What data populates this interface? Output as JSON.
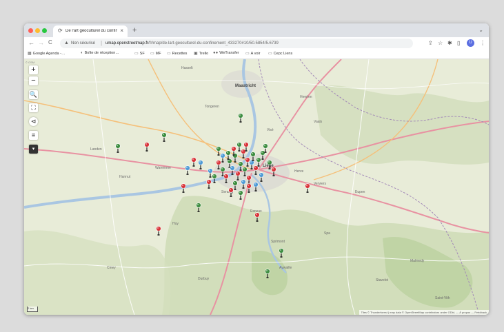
{
  "browser": {
    "tab_title": "De l'art géoculturel du confin…",
    "tab_close": "×",
    "newtab": "+",
    "tabmenu": "⌄",
    "tab_favicon": "refresh-icon",
    "back": "←",
    "forward": "→",
    "reload": "C",
    "security_label": "Non sécurisé",
    "url_host": "umap.openstreetmap.fr",
    "url_path": "/fr/map/de-lart-geoculturel-du-confinement_433270#10/50.5854/5.6739",
    "avatar_initial": "U"
  },
  "bookmarks": [
    {
      "icon": "▦",
      "label": "Google Agenda -…"
    },
    {
      "icon": "◐",
      "label": "Boîte de réception…"
    },
    {
      "icon": "▭",
      "label": "SF"
    },
    {
      "icon": "▭",
      "label": "MF"
    },
    {
      "icon": "▭",
      "label": "Recettes"
    },
    {
      "icon": "▣",
      "label": "Trello"
    },
    {
      "icon": "●●",
      "label": "WeTransfer"
    },
    {
      "icon": "▭",
      "label": "A voir"
    },
    {
      "icon": "▭",
      "label": "Cepc Liens"
    }
  ],
  "map": {
    "corner_label": "© OSM",
    "controls": [
      "+",
      "−",
      "🔍",
      "⛶",
      "⊲",
      "≡",
      "▾"
    ],
    "places": [
      {
        "name": "Maastricht",
        "cls": "city"
      },
      {
        "name": "Liège",
        "cls": "city"
      },
      {
        "name": "Verviers",
        "cls": ""
      },
      {
        "name": "Hasselt",
        "cls": ""
      },
      {
        "name": "Tongeren",
        "cls": ""
      },
      {
        "name": "Huy",
        "cls": ""
      },
      {
        "name": "Waremme",
        "cls": ""
      },
      {
        "name": "Eupen",
        "cls": ""
      },
      {
        "name": "Spa",
        "cls": ""
      },
      {
        "name": "Esneux",
        "cls": ""
      },
      {
        "name": "Sprimont",
        "cls": ""
      },
      {
        "name": "Aywaille",
        "cls": ""
      },
      {
        "name": "Vaals",
        "cls": ""
      },
      {
        "name": "Heerlen",
        "cls": ""
      },
      {
        "name": "Landen",
        "cls": ""
      },
      {
        "name": "Hannut",
        "cls": ""
      },
      {
        "name": "Ciney",
        "cls": ""
      },
      {
        "name": "Durbuy",
        "cls": ""
      },
      {
        "name": "Malmedy",
        "cls": ""
      },
      {
        "name": "Stavelot",
        "cls": ""
      },
      {
        "name": "Seraing",
        "cls": ""
      },
      {
        "name": "Visé",
        "cls": ""
      },
      {
        "name": "Herve",
        "cls": ""
      },
      {
        "name": "Saint-Vith",
        "cls": ""
      }
    ],
    "markers_color_legend": {
      "red": "#d9343a",
      "green": "#3e8e41",
      "blue": "#4f9bd6"
    },
    "scale_label": "2 km",
    "attribution": "Tiles © Thunderforest | map data © OpenStreetMap contributors under ODbL — À propos — Feedback"
  }
}
